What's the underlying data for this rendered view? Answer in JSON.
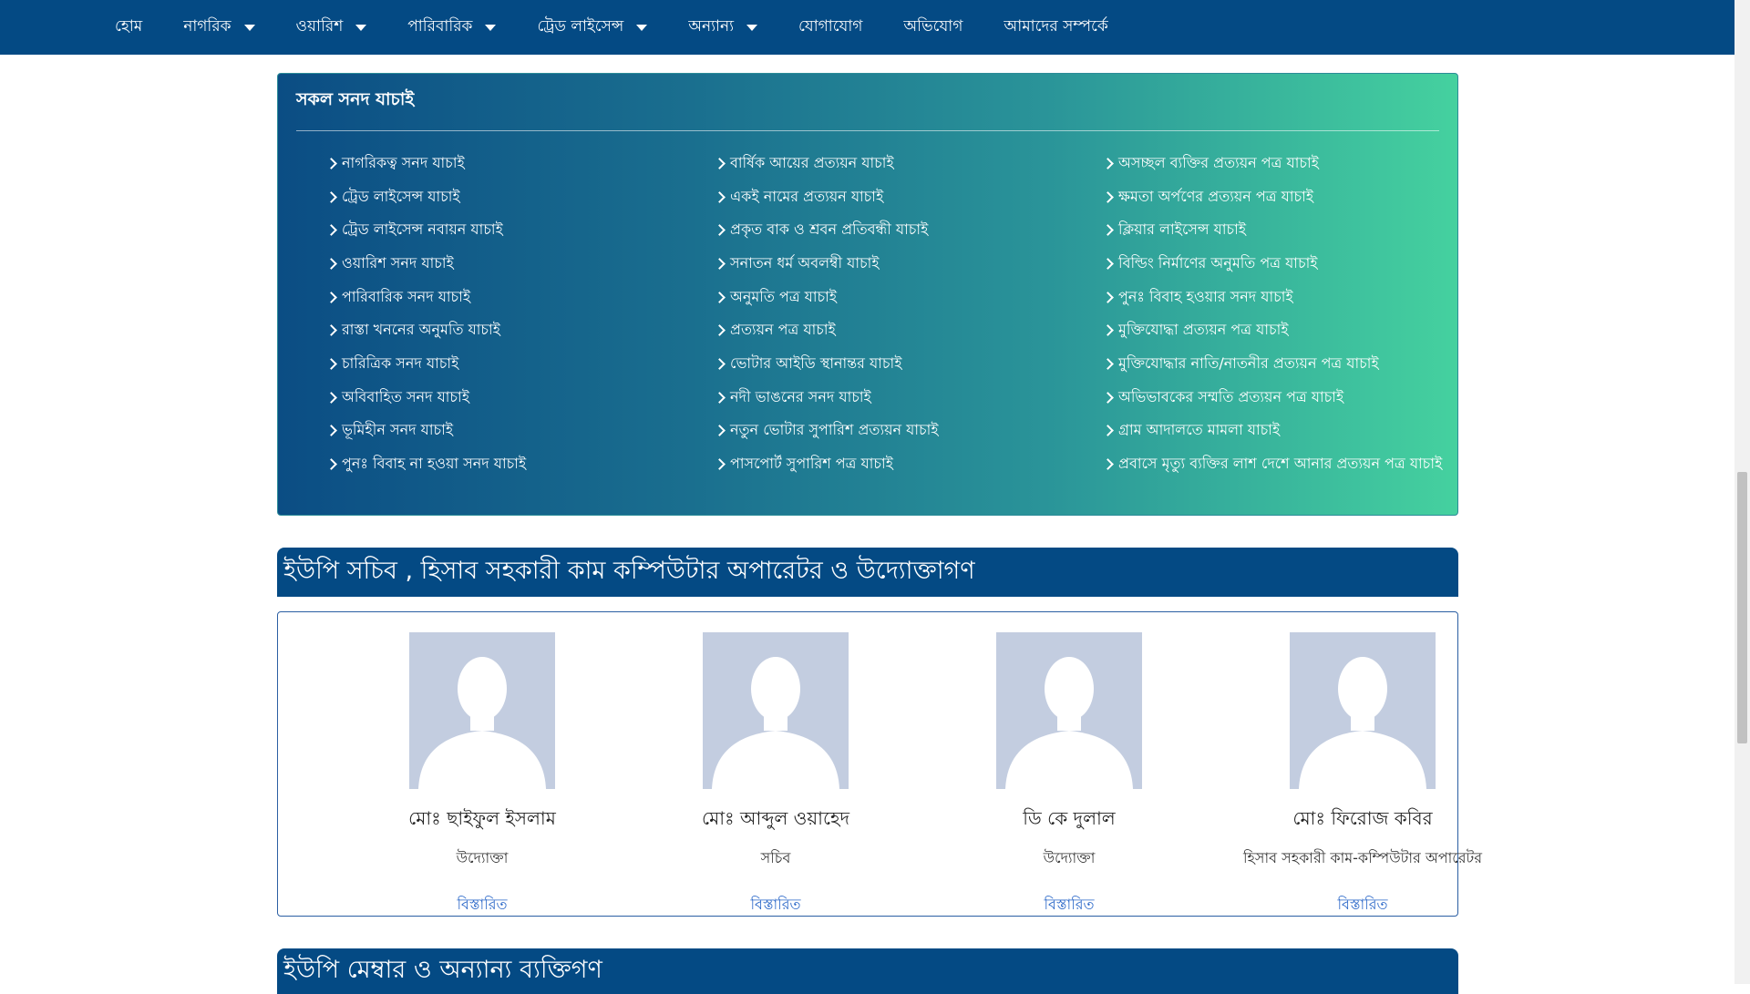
{
  "navbar": {
    "items": [
      {
        "label": "হোম",
        "dropdown": false
      },
      {
        "label": "নাগরিক",
        "dropdown": true
      },
      {
        "label": "ওয়ারিশ",
        "dropdown": true
      },
      {
        "label": "পারিবারিক",
        "dropdown": true
      },
      {
        "label": "ট্রেড লাইসেন্স",
        "dropdown": true
      },
      {
        "label": "অন্যান্য",
        "dropdown": true
      },
      {
        "label": "যোগাযোগ",
        "dropdown": false
      },
      {
        "label": "অভিযোগ",
        "dropdown": false
      },
      {
        "label": "আমাদের সম্পর্কে",
        "dropdown": false
      }
    ],
    "color": "#044a84"
  },
  "verify_panel": {
    "title": "সকল সনদ যাচাই",
    "columns": [
      [
        "নাগরিকত্ব সনদ যাচাই",
        "ট্রেড লাইসেন্স যাচাই",
        "ট্রেড লাইসেন্স নবায়ন যাচাই",
        "ওয়ারিশ সনদ যাচাই",
        "পারিবারিক সনদ যাচাই",
        "রাস্তা খননের অনুমতি যাচাই",
        "চারিত্রিক সনদ যাচাই",
        "অবিবাহিত সনদ যাচাই",
        "ভূমিহীন সনদ যাচাই",
        "পুনঃ বিবাহ না হওয়া সনদ যাচাই"
      ],
      [
        "বার্ষিক আয়ের প্রত্যয়ন যাচাই",
        "একই নামের প্রত্যয়ন যাচাই",
        "প্রকৃত বাক ও শ্রবন প্রতিবন্ধী যাচাই",
        "সনাতন ধর্ম অবলম্বী যাচাই",
        "অনুমতি পত্র যাচাই",
        "প্রত্যয়ন পত্র যাচাই",
        "ভোটার আইডি স্থানান্তর যাচাই",
        "নদী ভাঙনের সনদ যাচাই",
        "নতুন ভোটার সুপারিশ প্রত্যয়ন যাচাই",
        "পাসপোর্ট সুপারিশ পত্র যাচাই"
      ],
      [
        "অসচ্ছল ব্যক্তির প্রত্যয়ন পত্র যাচাই",
        "ক্ষমতা অর্পণের প্রত্যয়ন পত্র যাচাই",
        "ক্লিয়ার লাইসেন্স যাচাই",
        "বিল্ডিং নির্মাণের অনুমতি পত্র যাচাই",
        "পুনঃ বিবাহ হওয়ার সনদ যাচাই",
        "মুক্তিযোদ্ধা প্রত্যয়ন পত্র যাচাই",
        "মুক্তিযোদ্ধার নাতি/নাতনীর প্রত্যয়ন পত্র যাচাই",
        "অভিভাবকের সম্মতি প্রত্যয়ন পত্র যাচাই",
        "গ্রাম আদালতে মামলা যাচাই",
        "প্রবাসে মৃত্যু ব্যক্তির লাশ দেশে আনার প্রত্যয়ন পত্র যাচাই"
      ]
    ]
  },
  "officials_section": {
    "title": "ইউপি সচিব , হিসাব সহকারী কাম কম্পিউটার অপারেটর ও উদ্যোক্তাগণ",
    "people": [
      {
        "name": "মোঃ ছাইফুল ইসলাম",
        "role": "উদ্যোক্তা",
        "link": "বিস্তারিত"
      },
      {
        "name": "মোঃ আব্দুল ওয়াহেদ",
        "role": "সচিব",
        "link": "বিস্তারিত"
      },
      {
        "name": "ডি কে দুলাল",
        "role": "উদ্যোক্তা",
        "link": "বিস্তারিত"
      },
      {
        "name": "মোঃ ফিরোজ কবির",
        "role": "হিসাব সহকারী কাম-কম্পিউটার অপারেটর",
        "link": "বিস্তারিত"
      }
    ]
  },
  "members_section": {
    "title": "ইউপি মেম্বার ও অন্যান্য ব্যক্তিগণ"
  }
}
